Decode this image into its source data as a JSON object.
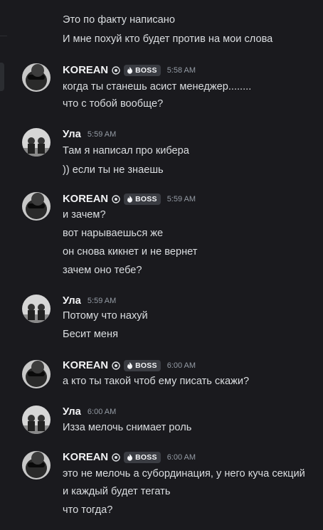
{
  "orphan_lines": [
    "Это по факту написано",
    "И мне похуй кто будет против на мои слова"
  ],
  "messages": [
    {
      "author": "KOREAN",
      "role": "BOSS",
      "time": "5:58 AM",
      "lines": [
        "когда ты станешь асист менеджер........",
        "что с тобой вообще?"
      ]
    },
    {
      "author": "Ула",
      "time": "5:59 AM",
      "lines": [
        "Там я написал про кибера",
        ")) если ты не знаешь"
      ]
    },
    {
      "author": "KOREAN",
      "role": "BOSS",
      "time": "5:59 AM",
      "lines": [
        "и зачем?",
        "вот нарываешься же",
        "он снова кикнет и не вернет",
        "зачем оно тебе?"
      ]
    },
    {
      "author": "Ула",
      "time": "5:59 AM",
      "lines": [
        "Потому что нахуй",
        "Бесит меня"
      ]
    },
    {
      "author": "KOREAN",
      "role": "BOSS",
      "time": "6:00 AM",
      "lines": [
        "а кто ты такой чтоб ему писать скажи?"
      ]
    },
    {
      "author": "Ула",
      "time": "6:00 AM",
      "lines": [
        "Изза мелочь снимает роль"
      ]
    },
    {
      "author": "KOREAN",
      "role": "BOSS",
      "time": "6:00 AM",
      "lines": [
        "это не мелочь а субординация, у него куча секций",
        "и каждый будет тегать",
        "что тогда?"
      ]
    }
  ],
  "colors": {
    "background": "#1a1a1e",
    "text": "#dbdee1",
    "name": "#f2f3f5",
    "timestamp": "#949ba4",
    "badge_bg": "#3a3c42"
  },
  "icons": {
    "guild_tag": "shield-tag-icon",
    "boss_role": "fire-icon"
  }
}
